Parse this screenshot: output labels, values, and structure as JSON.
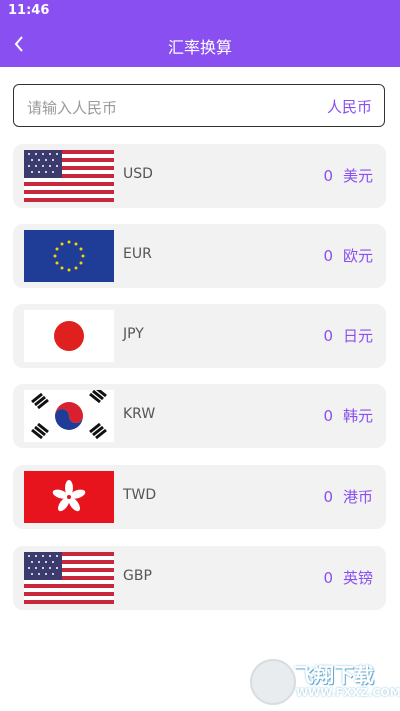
{
  "status": {
    "time": "11:46"
  },
  "header": {
    "title": "汇率换算"
  },
  "input": {
    "placeholder": "请输入人民币",
    "unit": "人民币"
  },
  "currencies": [
    {
      "code": "USD",
      "value": "0",
      "unit": "美元",
      "flag": "us-flag-icon"
    },
    {
      "code": "EUR",
      "value": "0",
      "unit": "欧元",
      "flag": "eu-flag-icon"
    },
    {
      "code": "JPY",
      "value": "0",
      "unit": "日元",
      "flag": "japan-flag-icon"
    },
    {
      "code": "KRW",
      "value": "0",
      "unit": "韩元",
      "flag": "korea-flag-icon"
    },
    {
      "code": "TWD",
      "value": "0",
      "unit": "港币",
      "flag": "hongkong-flag-icon"
    },
    {
      "code": "GBP",
      "value": "0",
      "unit": "英镑",
      "flag": "us-flag-icon"
    }
  ],
  "watermark": {
    "name": "飞翔下载",
    "url": "WWW.FXXZ.COM"
  },
  "colors": {
    "accent": "#8a4ff0",
    "row_bg": "#f2f2f2"
  }
}
